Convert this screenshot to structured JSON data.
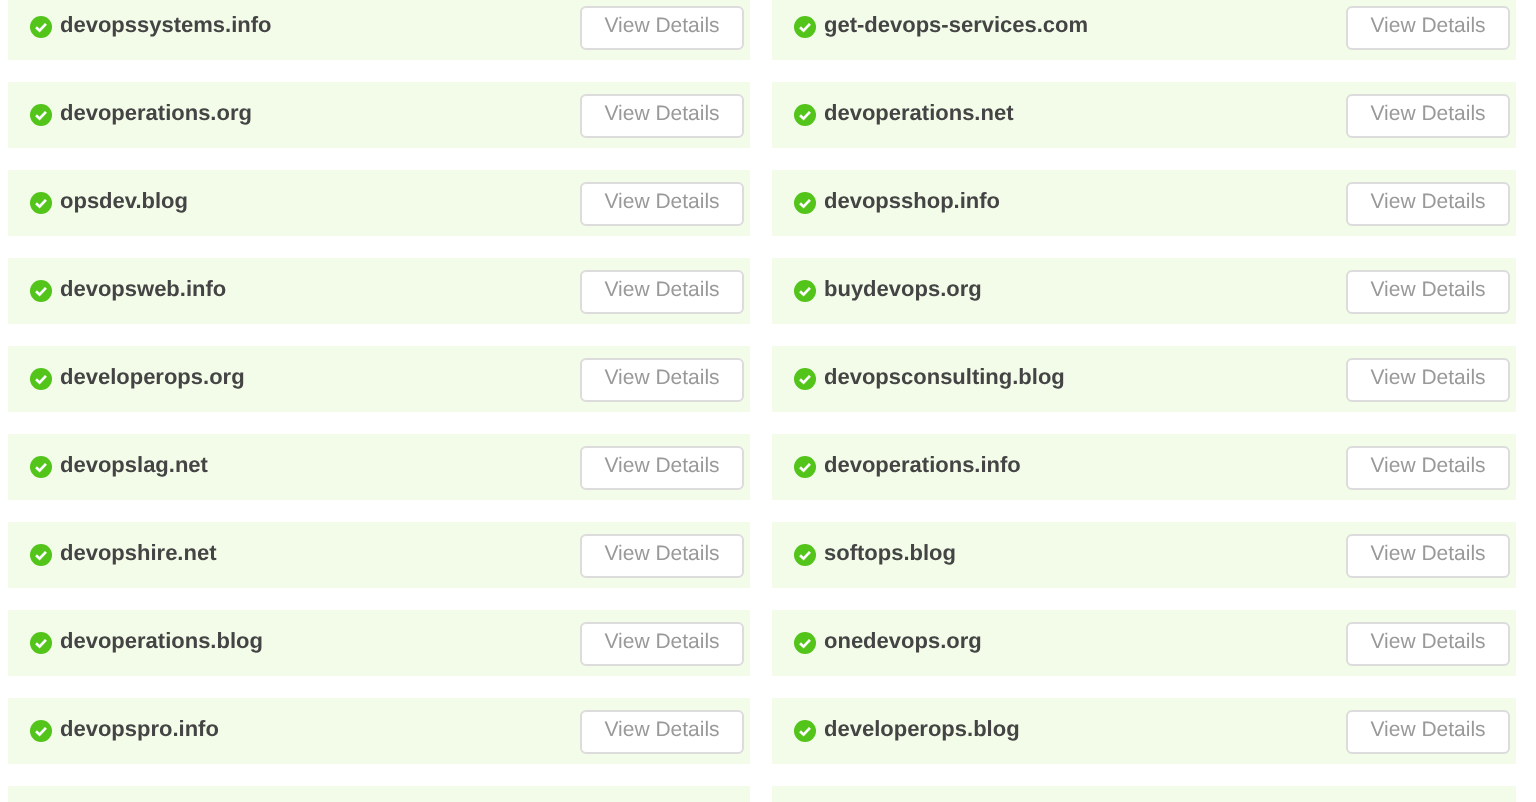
{
  "domains": [
    {
      "name": "devopssystems.info",
      "button": "View Details"
    },
    {
      "name": "get-devops-services.com",
      "button": "View Details"
    },
    {
      "name": "devoperations.org",
      "button": "View Details"
    },
    {
      "name": "devoperations.net",
      "button": "View Details"
    },
    {
      "name": "opsdev.blog",
      "button": "View Details"
    },
    {
      "name": "devopsshop.info",
      "button": "View Details"
    },
    {
      "name": "devopsweb.info",
      "button": "View Details"
    },
    {
      "name": "buydevops.org",
      "button": "View Details"
    },
    {
      "name": "developerops.org",
      "button": "View Details"
    },
    {
      "name": "devopsconsulting.blog",
      "button": "View Details"
    },
    {
      "name": "devopslag.net",
      "button": "View Details"
    },
    {
      "name": "devoperations.info",
      "button": "View Details"
    },
    {
      "name": "devopshire.net",
      "button": "View Details"
    },
    {
      "name": "softops.blog",
      "button": "View Details"
    },
    {
      "name": "devoperations.blog",
      "button": "View Details"
    },
    {
      "name": "onedevops.org",
      "button": "View Details"
    },
    {
      "name": "devopspro.info",
      "button": "View Details"
    },
    {
      "name": "developerops.blog",
      "button": "View Details"
    }
  ]
}
